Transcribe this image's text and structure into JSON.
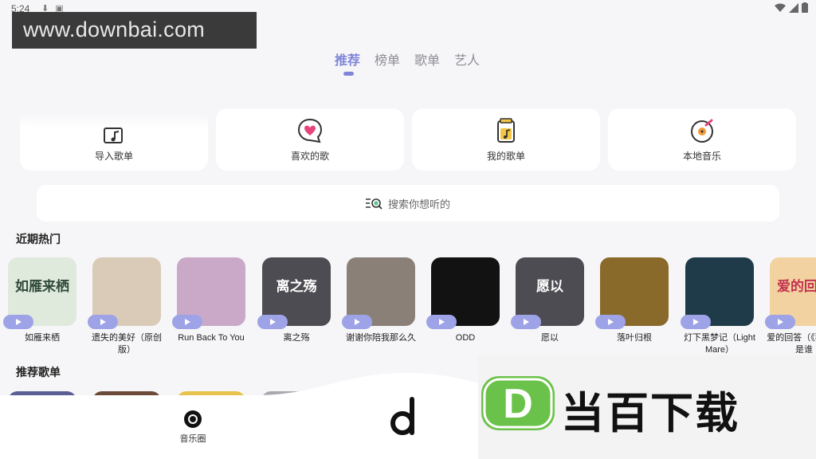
{
  "status_bar": {
    "time": "5:24"
  },
  "watermark_top": "www.downbai.com",
  "top_tabs": [
    {
      "label": "推荐",
      "active": true
    },
    {
      "label": "榜单",
      "active": false
    },
    {
      "label": "歌单",
      "active": false
    },
    {
      "label": "艺人",
      "active": false
    }
  ],
  "cards": [
    {
      "label": "导入歌单",
      "icon": "import-playlist-icon"
    },
    {
      "label": "喜欢的歌",
      "icon": "heart-chat-icon"
    },
    {
      "label": "我的歌单",
      "icon": "music-list-icon"
    },
    {
      "label": "本地音乐",
      "icon": "vinyl-icon"
    }
  ],
  "search": {
    "placeholder": "搜索你想听的"
  },
  "sections": {
    "hot": "近期热门",
    "recommended": "推荐歌单"
  },
  "hot_songs": [
    {
      "title": "如雁来栖",
      "cover_text": "如雁来栖",
      "bg": "#dfe9dc",
      "fg": "#2f4a3a"
    },
    {
      "title": "遗失的美好（原创版）",
      "cover_text": "",
      "bg": "#d9cbb8",
      "fg": "#4a3a2a"
    },
    {
      "title": "Run Back To You",
      "cover_text": "",
      "bg": "#c9a8c8",
      "fg": "#222"
    },
    {
      "title": "离之殇",
      "cover_text": "离之殇",
      "bg": "#4c4c52",
      "fg": "#ffffff"
    },
    {
      "title": "谢谢你陪我那么久",
      "cover_text": "",
      "bg": "#8a8077",
      "fg": "#fff"
    },
    {
      "title": "ODD",
      "cover_text": "",
      "bg": "#121212",
      "fg": "#d33"
    },
    {
      "title": "愿以",
      "cover_text": "愿以",
      "bg": "#4c4c52",
      "fg": "#ffffff"
    },
    {
      "title": "落叶归根",
      "cover_text": "",
      "bg": "#8a6a2a",
      "fg": "#fff"
    },
    {
      "title": "灯下黑梦记（Light Mare）",
      "cover_text": "",
      "bg": "#1f3b4a",
      "fg": "#cfe"
    },
    {
      "title": "爱的回答（《猜猜我是谁",
      "cover_text": "爱的回答",
      "bg": "#f2d2a0",
      "fg": "#c2334f"
    }
  ],
  "bottom_nav": {
    "radio_label": "音乐圈"
  },
  "watermark_bottom": {
    "text": "当百下载",
    "logo_letter": "D"
  },
  "colors": {
    "accent": "#7f84d8",
    "play_badge": "#9da3e6",
    "card_bg": "#ffffff",
    "page_bg": "#f6f6f8"
  }
}
